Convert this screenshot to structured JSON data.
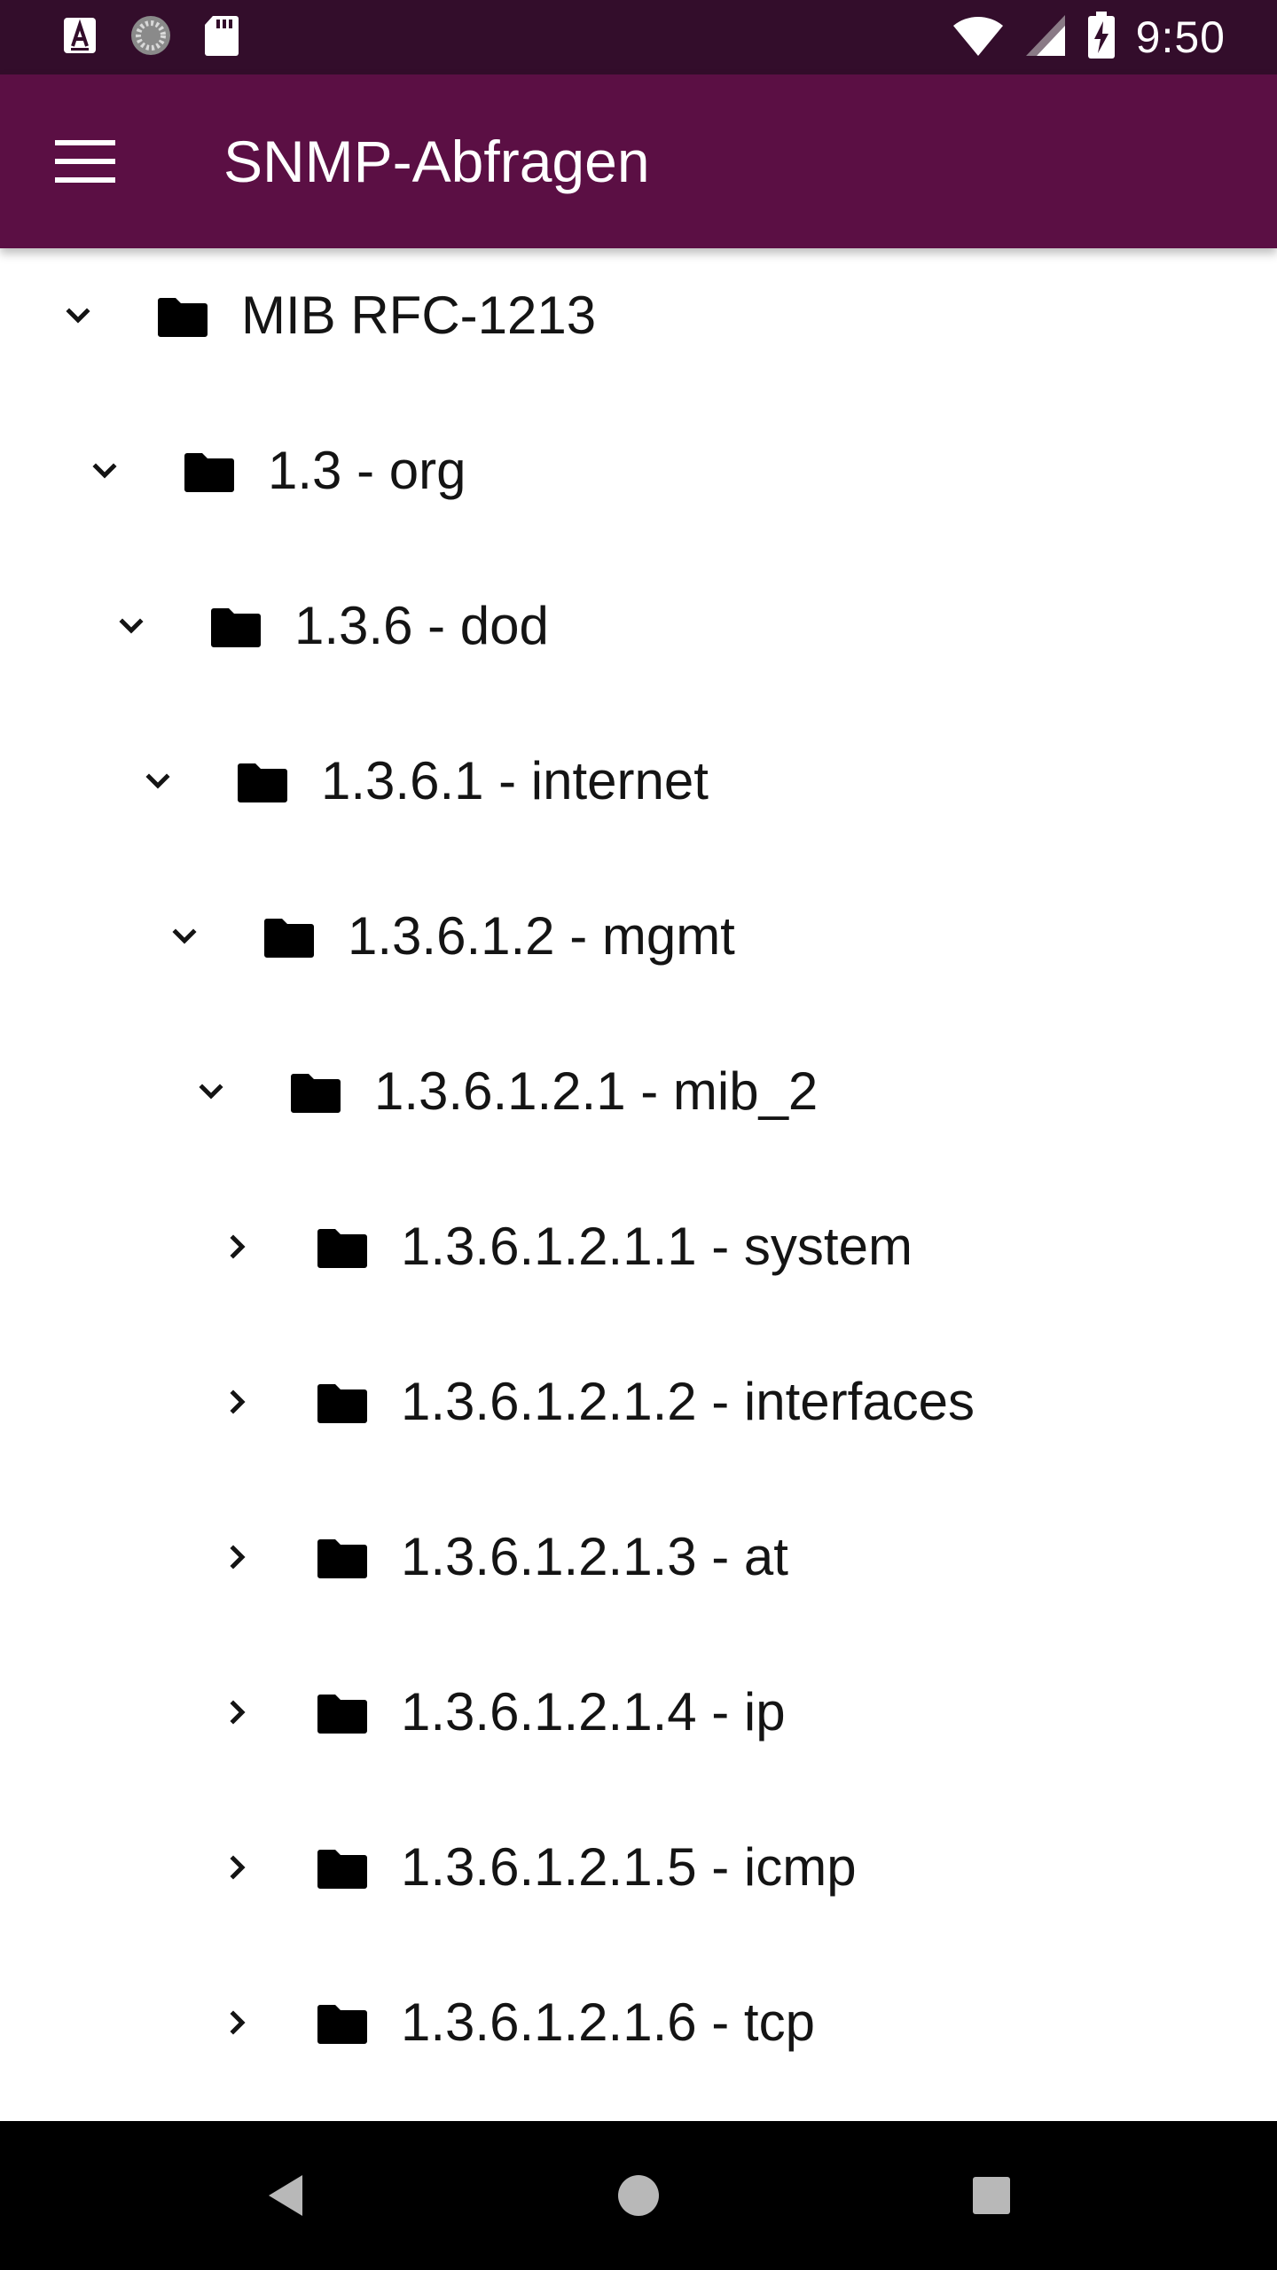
{
  "status_bar": {
    "time": "9:50",
    "left_icons": [
      "text-a-icon",
      "loading-circle-icon",
      "sd-card-icon"
    ],
    "right_icons": [
      "wifi-icon",
      "cellular-signal-icon",
      "battery-charging-icon"
    ]
  },
  "app_bar": {
    "title": "SNMP-Abfragen",
    "menu_icon": "hamburger-menu-icon",
    "color": "#5b0f44"
  },
  "tree": {
    "items": [
      {
        "label": "MIB RFC-1213",
        "level": 0,
        "expanded": true
      },
      {
        "label": "1.3 - org",
        "level": 1,
        "expanded": true
      },
      {
        "label": "1.3.6 - dod",
        "level": 2,
        "expanded": true
      },
      {
        "label": "1.3.6.1 - internet",
        "level": 3,
        "expanded": true
      },
      {
        "label": "1.3.6.1.2 - mgmt",
        "level": 4,
        "expanded": true
      },
      {
        "label": "1.3.6.1.2.1 - mib_2",
        "level": 5,
        "expanded": true
      },
      {
        "label": "1.3.6.1.2.1.1 - system",
        "level": 6,
        "expanded": false
      },
      {
        "label": "1.3.6.1.2.1.2 - interfaces",
        "level": 6,
        "expanded": false
      },
      {
        "label": "1.3.6.1.2.1.3 - at",
        "level": 6,
        "expanded": false
      },
      {
        "label": "1.3.6.1.2.1.4 - ip",
        "level": 6,
        "expanded": false
      },
      {
        "label": "1.3.6.1.2.1.5 - icmp",
        "level": 6,
        "expanded": false
      },
      {
        "label": "1.3.6.1.2.1.6 - tcp",
        "level": 6,
        "expanded": false
      }
    ]
  },
  "nav_bar": {
    "buttons": [
      "back-icon",
      "home-icon",
      "recents-icon"
    ]
  },
  "colors": {
    "status_bar": "#330d2b",
    "app_bar": "#5b0f44",
    "text": "#141414"
  }
}
